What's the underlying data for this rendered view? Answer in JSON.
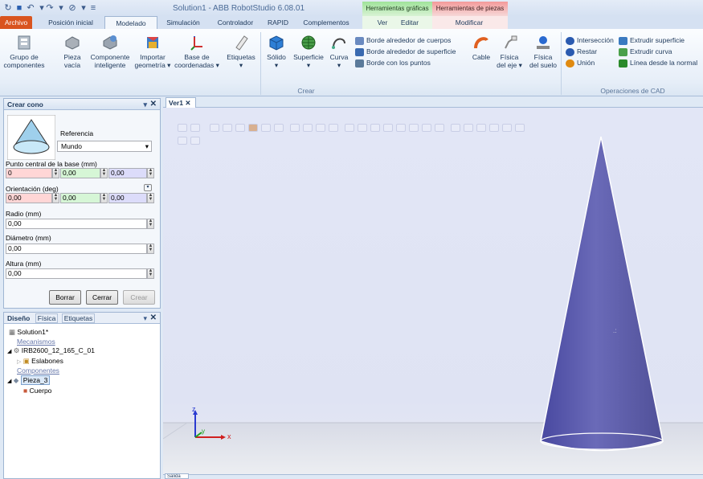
{
  "title": "Solution1 - ABB RobotStudio 6.08.01",
  "contextual_tabs": {
    "graphics": "Herramientas gráficas",
    "pieces": "Herramientas de piezas"
  },
  "tabs": [
    "Archivo",
    "Posición inicial",
    "Modelado",
    "Simulación",
    "Controlador",
    "RAPID",
    "Complementos",
    "Ver",
    "Editar",
    "Modificar"
  ],
  "ribbon": {
    "large_buttons": [
      {
        "label1": "Grupo de",
        "label2": "componentes",
        "icon": "component-group-icon"
      },
      {
        "label1": "Pieza",
        "label2": "vacía",
        "icon": "empty-part-icon"
      },
      {
        "label1": "Componente",
        "label2": "inteligente",
        "icon": "smart-component-icon"
      },
      {
        "label1": "Importar",
        "label2": "geometría ▾",
        "icon": "import-geometry-icon"
      },
      {
        "label1": "Base de",
        "label2": "coordenadas ▾",
        "icon": "frame-icon"
      },
      {
        "label1": "Etiquetas",
        "label2": "▾",
        "icon": "tags-icon"
      },
      {
        "label1": "Sólido",
        "label2": "▾",
        "icon": "solid-icon"
      },
      {
        "label1": "Superficie",
        "label2": "▾",
        "icon": "surface-icon"
      },
      {
        "label1": "Curva",
        "label2": "▾",
        "icon": "curve-icon"
      }
    ],
    "border_buttons": [
      "Borde alrededor de cuerpos",
      "Borde alrededor de superficie",
      "Borde con los puntos"
    ],
    "physics_buttons": [
      {
        "label1": "Cable",
        "label2": "",
        "icon": "cable-icon"
      },
      {
        "label1": "Física",
        "label2": "del eje ▾",
        "icon": "joint-physics-icon"
      },
      {
        "label1": "Física",
        "label2": "del suelo",
        "icon": "ground-physics-icon"
      }
    ],
    "cad_left": [
      "Intersección",
      "Restar",
      "Unión"
    ],
    "cad_right": [
      "Extrudir superficie",
      "Extrudir curva",
      "Línea desde la normal"
    ],
    "group_create": "Crear",
    "group_cad": "Operaciones de CAD"
  },
  "create_cone": {
    "title": "Crear cono",
    "reference_label": "Referencia",
    "reference_value": "Mundo",
    "base_label": "Punto central de la base (mm)",
    "base_values": [
      "0",
      "0,00",
      "0,00"
    ],
    "orientation_label": "Orientación (deg)",
    "orientation_values": [
      "0,00",
      "0,00",
      "0,00"
    ],
    "radius_label": "Radio (mm)",
    "radius_value": "0,00",
    "diameter_label": "Diámetro (mm)",
    "diameter_value": "0,00",
    "height_label": "Altura (mm)",
    "height_value": "0,00",
    "buttons": {
      "clear": "Borrar",
      "close": "Cerrar",
      "create": "Crear"
    }
  },
  "layout_panel": {
    "tabs": [
      "Diseño",
      "Física",
      "Etiquetas"
    ],
    "tree": {
      "solution": "Solution1*",
      "mechanisms": "Mecanismos",
      "robot": "IRB2600_12_165_C_01",
      "links": "Eslabones",
      "components": "Componentes",
      "part": "Pieza_3",
      "body": "Cuerpo"
    }
  },
  "view": {
    "tab": "Ver1",
    "axis_x": "x",
    "axis_y": "y",
    "axis_z": "z"
  },
  "output_tab": "Salida",
  "colors": {
    "archivo": "#d9541f",
    "cone": "#5a5aa8",
    "viewport": "#e0e4f5"
  }
}
